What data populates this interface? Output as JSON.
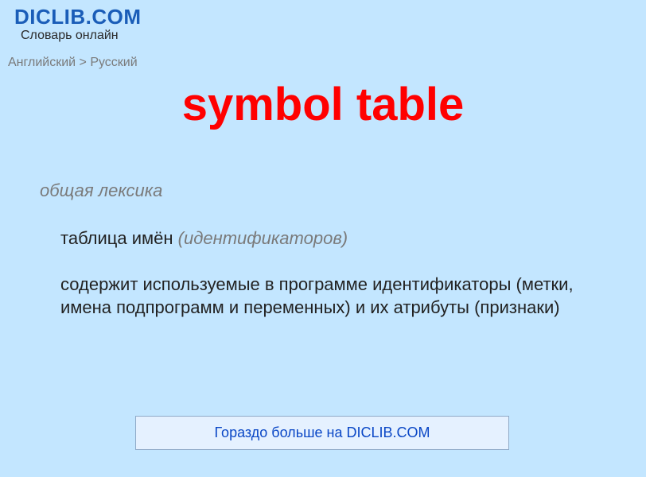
{
  "header": {
    "title": "DICLIB.COM",
    "subtitle": "Словарь онлайн"
  },
  "breadcrumb": "Английский > Русский",
  "entry": {
    "title": "symbol table",
    "category": "общая лексика",
    "definition_main": "таблица имён ",
    "definition_qualifier": "(идентификаторов)",
    "definition_full": "содержит используемые в программе идентификаторы (метки, имена подпрограмм и переменных) и их атрибуты (признаки)"
  },
  "cta": {
    "label": "Гораздо больше на DICLIB.COM"
  }
}
